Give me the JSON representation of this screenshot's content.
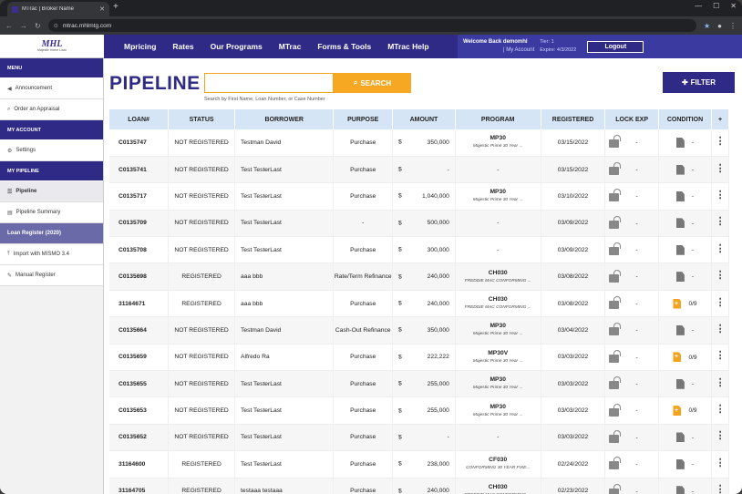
{
  "browser": {
    "tab_title": "MTrac | Broker Name",
    "url": "mtrac.mhlmtg.com"
  },
  "header": {
    "logo_text": "MHL",
    "logo_subtext": "Majestic Home Loan",
    "nav": [
      "Mpricing",
      "Rates",
      "Our Programs",
      "MTrac",
      "Forms & Tools",
      "MTrac Help"
    ],
    "welcome": "Welcome Back demomhl",
    "my_account": "| My Account",
    "tier": "Tier: 1",
    "expire": "Expire: 4/3/2022",
    "logout": "Logout"
  },
  "sidebar": {
    "menu_head": "MENU",
    "menu_items": [
      {
        "icon": "megaphone-icon",
        "glyph": "📢",
        "label": "Announcement"
      },
      {
        "icon": "search-icon",
        "glyph": "🔍",
        "label": "Order an Appraisal"
      }
    ],
    "account_head": "MY ACCOUNT",
    "account_items": [
      {
        "icon": "gear-icon",
        "glyph": "⚙",
        "label": "Settings"
      }
    ],
    "pipeline_head": "MY PIPELINE",
    "pipeline_items": [
      {
        "icon": "list-icon",
        "glyph": "☰",
        "label": "Pipeline"
      },
      {
        "icon": "chart-icon",
        "glyph": "▤",
        "label": "Pipeline Summary"
      },
      {
        "icon": "",
        "glyph": "",
        "label": "Loan Register (2020)"
      },
      {
        "icon": "upload-icon",
        "glyph": "⤒",
        "label": "Import with MISMO 3.4"
      },
      {
        "icon": "edit-icon",
        "glyph": "✎",
        "label": "Manual Register"
      }
    ]
  },
  "main": {
    "title": "PIPELINE",
    "search_placeholder": "",
    "search_button": "SEARCH",
    "search_hint": "Search by First Name, Loan Number, or Case Number",
    "filter_button": "FILTER"
  },
  "table": {
    "columns": [
      "LOAN#",
      "STATUS",
      "BORROWER",
      "PURPOSE",
      "AMOUNT",
      "PROGRAM",
      "REGISTERED",
      "LOCK EXP",
      "CONDITION",
      "+"
    ],
    "rows": [
      {
        "loan": "C0135747",
        "status": "NOT REGISTERED",
        "borrower": "Testman David",
        "purpose": "Purchase",
        "amount": "350,000",
        "prog_code": "MP30",
        "prog_desc": "Majestic Prime 30 Year ...",
        "registered": "03/15/2022",
        "lock_exp": "-",
        "cond_alert": false,
        "condition": "-"
      },
      {
        "loan": "C0135741",
        "status": "NOT REGISTERED",
        "borrower": "Test TesterLast",
        "purpose": "Purchase",
        "amount": "-",
        "prog_code": "",
        "prog_desc": "-",
        "registered": "03/15/2022",
        "lock_exp": "-",
        "cond_alert": false,
        "condition": "-"
      },
      {
        "loan": "C0135717",
        "status": "NOT REGISTERED",
        "borrower": "Test TesterLast",
        "purpose": "Purchase",
        "amount": "1,040,000",
        "prog_code": "MP30",
        "prog_desc": "Majestic Prime 30 Year ...",
        "registered": "03/10/2022",
        "lock_exp": "-",
        "cond_alert": false,
        "condition": "-"
      },
      {
        "loan": "C0135709",
        "status": "NOT REGISTERED",
        "borrower": "Test TesterLast",
        "purpose": "-",
        "amount": "500,000",
        "prog_code": "",
        "prog_desc": "-",
        "registered": "03/09/2022",
        "lock_exp": "-",
        "cond_alert": false,
        "condition": "-"
      },
      {
        "loan": "C0135708",
        "status": "NOT REGISTERED",
        "borrower": "Test TesterLast",
        "purpose": "Purchase",
        "amount": "300,000",
        "prog_code": "",
        "prog_desc": "-",
        "registered": "03/09/2022",
        "lock_exp": "-",
        "cond_alert": false,
        "condition": "-"
      },
      {
        "loan": "C0135698",
        "status": "REGISTERED",
        "borrower": "aaa bbb",
        "purpose": "Rate/Term Refinance",
        "amount": "240,000",
        "prog_code": "CH030",
        "prog_desc": "FREDDIE MAC CONFORMING ...",
        "registered": "03/08/2022",
        "lock_exp": "-",
        "cond_alert": false,
        "condition": "-"
      },
      {
        "loan": "31164671",
        "status": "REGISTERED",
        "borrower": "aaa bbb",
        "purpose": "Purchase",
        "amount": "240,000",
        "prog_code": "CH030",
        "prog_desc": "FREDDIE MAC CONFORMING ...",
        "registered": "03/08/2022",
        "lock_exp": "-",
        "cond_alert": true,
        "condition": "0/9"
      },
      {
        "loan": "C0135664",
        "status": "NOT REGISTERED",
        "borrower": "Testman David",
        "purpose": "Cash-Out Refinance",
        "amount": "350,000",
        "prog_code": "MP30",
        "prog_desc": "Majestic Prime 30 Year ...",
        "registered": "03/04/2022",
        "lock_exp": "-",
        "cond_alert": false,
        "condition": "-"
      },
      {
        "loan": "C0135659",
        "status": "NOT REGISTERED",
        "borrower": "Alfredo Ra",
        "purpose": "Purchase",
        "amount": "222,222",
        "prog_code": "MP30V",
        "prog_desc": "Majestic Prime 30 Year ...",
        "registered": "03/03/2022",
        "lock_exp": "-",
        "cond_alert": true,
        "condition": "0/9"
      },
      {
        "loan": "C0135655",
        "status": "NOT REGISTERED",
        "borrower": "Test TesterLast",
        "purpose": "Purchase",
        "amount": "255,000",
        "prog_code": "MP30",
        "prog_desc": "Majestic Prime 30 Year ...",
        "registered": "03/03/2022",
        "lock_exp": "-",
        "cond_alert": false,
        "condition": "-"
      },
      {
        "loan": "C0135653",
        "status": "NOT REGISTERED",
        "borrower": "Test TesterLast",
        "purpose": "Purchase",
        "amount": "255,000",
        "prog_code": "MP30",
        "prog_desc": "Majestic Prime 30 Year ...",
        "registered": "03/03/2022",
        "lock_exp": "-",
        "cond_alert": true,
        "condition": "0/9"
      },
      {
        "loan": "C0135652",
        "status": "NOT REGISTERED",
        "borrower": "Test TesterLast",
        "purpose": "Purchase",
        "amount": "-",
        "prog_code": "",
        "prog_desc": "-",
        "registered": "03/03/2022",
        "lock_exp": "-",
        "cond_alert": false,
        "condition": "-"
      },
      {
        "loan": "31164600",
        "status": "REGISTERED",
        "borrower": "Test TesterLast",
        "purpose": "Purchase",
        "amount": "238,000",
        "prog_code": "CF030",
        "prog_desc": "CONFORMING 30 YEAR FIXE...",
        "registered": "02/24/2022",
        "lock_exp": "-",
        "cond_alert": false,
        "condition": "-"
      },
      {
        "loan": "31164705",
        "status": "REGISTERED",
        "borrower": "testaaa testaaa",
        "purpose": "Purchase",
        "amount": "240,000",
        "prog_code": "CH030",
        "prog_desc": "FREDDIE MAC CONFORMING ...",
        "registered": "02/23/2022",
        "lock_exp": "-",
        "cond_alert": false,
        "condition": "-"
      }
    ]
  }
}
